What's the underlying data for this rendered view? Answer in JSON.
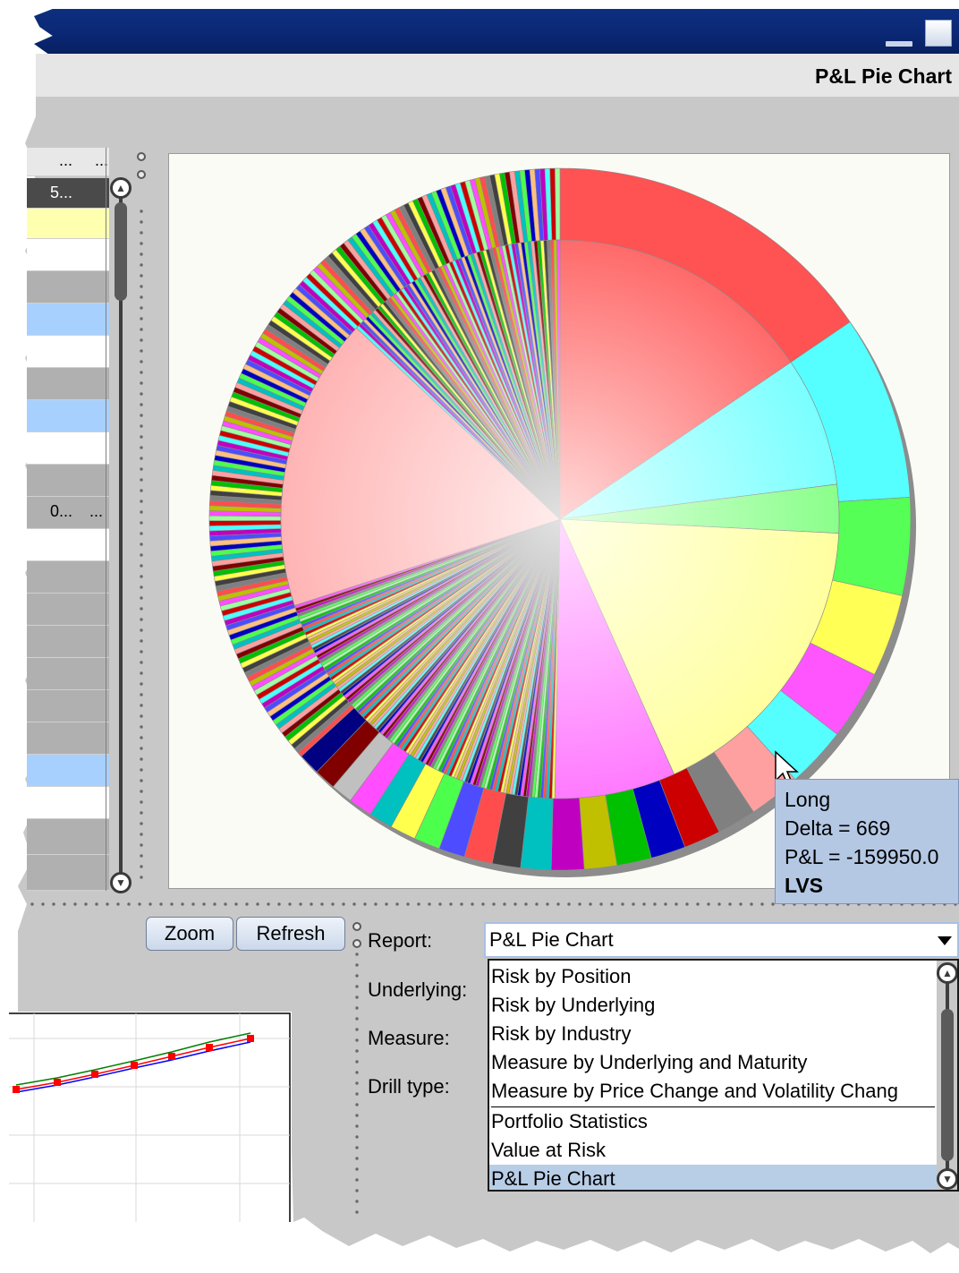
{
  "window": {
    "title": "P&L Pie Chart"
  },
  "grid": {
    "header_cells": [
      "...",
      "..."
    ],
    "selected_row_text": "5...",
    "row_text": [
      "0...",
      "..."
    ]
  },
  "chart_data": {
    "type": "pie",
    "title": "",
    "inner_ring": [
      {
        "label": "",
        "value": 18,
        "color": "#ff6060"
      },
      {
        "label": "",
        "value": 9,
        "color": "#7fffff"
      },
      {
        "label": "",
        "value": 3,
        "color": "#7fff7f"
      },
      {
        "label": "Long",
        "value": 20,
        "color": "#ffff90"
      },
      {
        "label": "",
        "value": 15,
        "color": "#ff60ff"
      },
      {
        "label": "",
        "value": 15,
        "color": "#8080ff"
      },
      {
        "label": "",
        "value": 20,
        "color": "#ffb0b0"
      }
    ],
    "tooltip": {
      "label": "Long",
      "delta": "Delta = 669",
      "pnl": "P&L = -159950.0",
      "symbol": "LVS"
    }
  },
  "colors": {
    "palette": [
      "#ff4d4d",
      "#4dffff",
      "#4dff4d",
      "#ffff4d",
      "#ff4dff",
      "#4d4dff",
      "#ffa0a0",
      "#808080",
      "#cc0000",
      "#0000c0",
      "#00c000",
      "#c0c000",
      "#c000c0",
      "#00c0c0",
      "#404040",
      "#a0ffa0",
      "#ffc080",
      "#800000"
    ]
  },
  "toolbar": {
    "zoom_label": "Zoom",
    "refresh_label": "Refresh"
  },
  "form": {
    "report_label": "Report:",
    "underlying_label": "Underlying:",
    "measure_label": "Measure:",
    "drill_label": "Drill type:",
    "report_value": "P&L Pie Chart"
  },
  "dropdown": {
    "items": [
      "Risk by Position",
      "Risk by Underlying",
      "Risk by Industry",
      "Measure by Underlying and Maturity",
      "Measure by Price Change and Volatility Chang",
      "Portfolio Statistics",
      "Value at Risk",
      "P&L Pie Chart"
    ],
    "selected_index": 7
  },
  "mini_chart": {
    "series": [
      {
        "color": "#008000",
        "values": [
          10,
          18,
          27,
          37,
          47,
          58,
          68
        ]
      },
      {
        "color": "#ff0000",
        "values": [
          5,
          13,
          22,
          32,
          42,
          52,
          62
        ]
      },
      {
        "color": "#0000ff",
        "values": [
          2,
          10,
          19,
          29,
          38,
          48,
          58
        ]
      }
    ]
  }
}
